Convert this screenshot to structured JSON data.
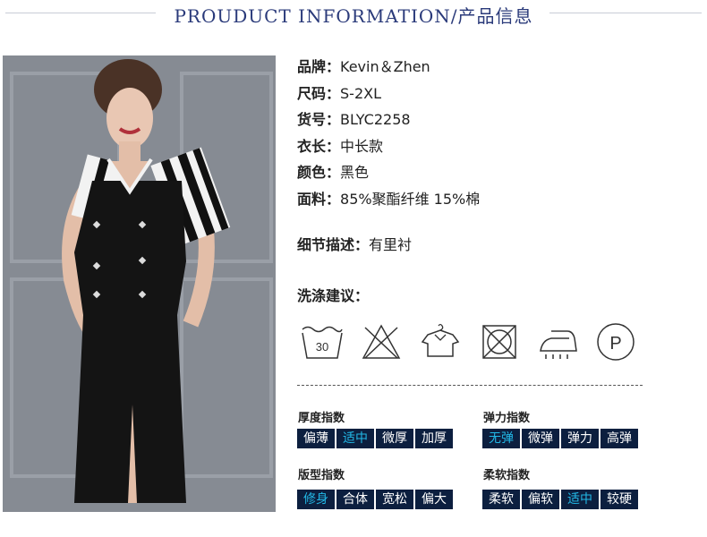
{
  "header": {
    "title": "PROUDUCT INFORMATION/产品信息"
  },
  "product": {
    "fields": [
      {
        "label": "品牌：",
        "value": "Kevin＆Zhen"
      },
      {
        "label": "尺码：",
        "value": "S-2XL"
      },
      {
        "label": "货号：",
        "value": "BLYC2258"
      },
      {
        "label": "衣长：",
        "value": "中长款"
      },
      {
        "label": "颜色：",
        "value": "黑色"
      },
      {
        "label": "面料：",
        "value": "85%聚酯纤维 15%棉"
      }
    ],
    "detail": {
      "label": "细节描述：",
      "value": "有里衬"
    }
  },
  "care": {
    "title": "洗涤建议：",
    "wash_temp": "30",
    "icons": [
      "wash-30-icon",
      "no-bleach-icon",
      "hang-dry-icon",
      "no-tumble-dry-icon",
      "low-iron-icon",
      "dry-clean-p-icon"
    ],
    "dry_clean_letter": "P"
  },
  "indices": [
    {
      "title": "厚度指数",
      "options": [
        "偏薄",
        "适中",
        "微厚",
        "加厚"
      ],
      "selected": 1
    },
    {
      "title": "弹力指数",
      "options": [
        "无弹",
        "微弹",
        "弹力",
        "高弹"
      ],
      "selected": 0
    },
    {
      "title": "版型指数",
      "options": [
        "修身",
        "合体",
        "宽松",
        "偏大"
      ],
      "selected": 0
    },
    {
      "title": "柔软指数",
      "options": [
        "柔软",
        "偏软",
        "适中",
        "较硬"
      ],
      "selected": 2
    }
  ],
  "colors": {
    "title": "#2a3a7a",
    "cell_bg": "#0c1f3f",
    "cell_selected_text": "#22b8e6"
  }
}
